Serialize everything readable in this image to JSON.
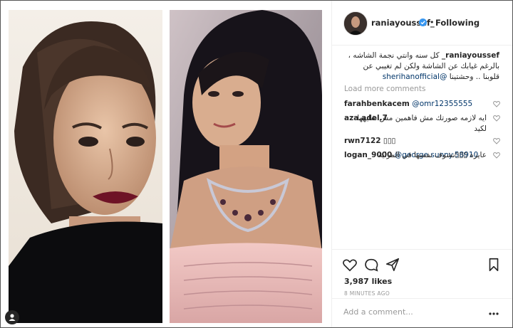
{
  "post": {
    "username": "raniayoussef_",
    "follow_state": "Following",
    "dot": "•",
    "caption_user": "raniayoussef_",
    "caption_text": "كل سنه وانتي نجمة الشاشه ، بالرغم غيابك عن الشاشة ولكن لم تغيبي عن قلوبنا .. وحشتينا",
    "caption_mention": "@sherihanofficial",
    "load_more": "Load more comments",
    "comments": [
      {
        "user": "farahbenkacem",
        "mention": "@omr12355555",
        "text": ""
      },
      {
        "user": "aza.adel.7",
        "mention": "",
        "text": "ايه لازمه صورتك مش فاهمين مش شايهها لكيد"
      },
      {
        "user": "rwn7122",
        "mention": "",
        "text": "▯▯▯"
      },
      {
        "user": "logan_9000",
        "mention": "@george.sunny.58910",
        "text": "عايزه ▯▯▯تشوف نفسها في المراية"
      }
    ],
    "likes": "3,987 likes",
    "time": "8 MINUTES AGO",
    "add_comment_placeholder": "Add a comment...",
    "colors": {
      "mention": "#003569",
      "verified": "#3897f0",
      "muted": "#999999"
    },
    "icons": [
      "heart-icon",
      "comment-icon",
      "share-icon",
      "bookmark-icon",
      "more-icon",
      "verified-badge-icon",
      "user-tag-icon"
    ]
  }
}
